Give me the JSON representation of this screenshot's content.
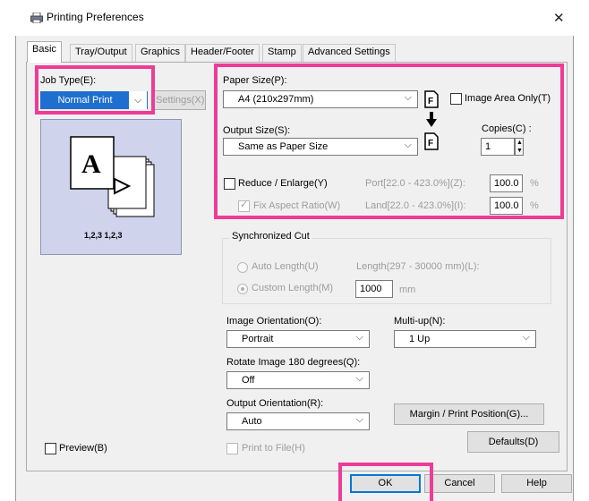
{
  "window": {
    "title": "Printing Preferences",
    "close": "✕"
  },
  "tabs": [
    "Basic",
    "Tray/Output",
    "Graphics",
    "Header/Footer",
    "Stamp",
    "Advanced Settings"
  ],
  "job_type": {
    "label": "Job Type(E):",
    "value": "Normal Print",
    "settings_button": "Settings(X)..."
  },
  "preview": {
    "page_letter": "A",
    "caption": "1,2,3 1,2,3"
  },
  "paper_size": {
    "label": "Paper Size(P):",
    "value": "A4 (210x297mm)",
    "image_area_only": "Image Area Only(T)"
  },
  "output_size": {
    "label": "Output Size(S):",
    "value": "Same as Paper Size"
  },
  "copies": {
    "label": "Copies(C) :",
    "value": "1"
  },
  "reduce_enlarge": {
    "label": "Reduce / Enlarge(Y)",
    "fix_aspect": "Fix Aspect Ratio(W)",
    "port_label": "Port[22.0 - 423.0%](Z):",
    "land_label": "Land[22.0 - 423.0%](I):",
    "port_value": "100.0",
    "land_value": "100.0",
    "unit": "%"
  },
  "sync_cut": {
    "title": "Synchronized Cut",
    "auto_length": "Auto Length(U)",
    "length_range": "Length(297 - 30000 mm)(L):",
    "custom_length": "Custom Length(M)",
    "custom_value": "1000",
    "unit": "mm"
  },
  "image_orientation": {
    "label": "Image Orientation(O):",
    "value": "Portrait"
  },
  "multi_up": {
    "label": "Multi-up(N):",
    "value": "1 Up"
  },
  "rotate": {
    "label": "Rotate Image 180 degrees(Q):",
    "value": "Off"
  },
  "output_orientation": {
    "label": "Output Orientation(R):",
    "value": "Auto"
  },
  "margin_button": "Margin / Print Position(G)...",
  "defaults_button": "Defaults(D)",
  "preview_checkbox": "Preview(B)",
  "print_to_file": "Print to File(H)",
  "footer": {
    "ok": "OK",
    "cancel": "Cancel",
    "help": "Help"
  },
  "colors": {
    "highlight": "#ef3b96",
    "selected": "#1f6fd1",
    "preview_bg": "#cfd4ec"
  }
}
